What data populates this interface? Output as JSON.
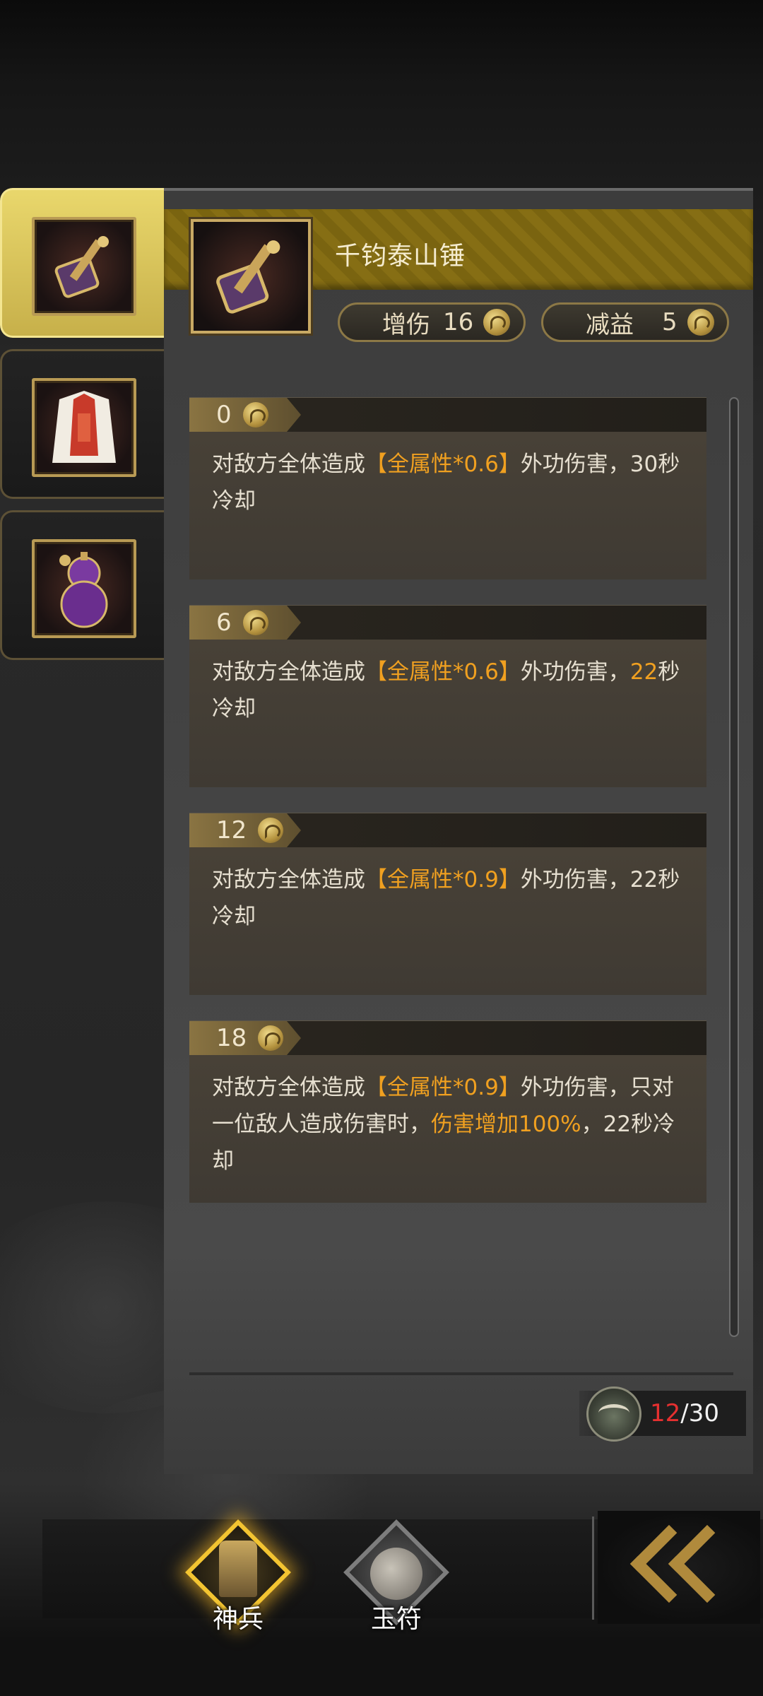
{
  "item": {
    "name": "千钧泰山锤",
    "stats": [
      {
        "label": "增伤",
        "value": "16"
      },
      {
        "label": "减益",
        "value": "5"
      }
    ]
  },
  "side_tabs": [
    {
      "icon": "hammer-icon",
      "active": true
    },
    {
      "icon": "robe-icon",
      "active": false
    },
    {
      "icon": "gourd-icon",
      "active": false
    }
  ],
  "tiers": [
    {
      "level": "0",
      "parts": [
        {
          "t": "对敌方全体造成"
        },
        {
          "t": "【全属性*0.6】",
          "hl": true
        },
        {
          "t": "外功伤害，30秒冷却"
        }
      ]
    },
    {
      "level": "6",
      "parts": [
        {
          "t": "对敌方全体造成"
        },
        {
          "t": "【全属性*0.6】",
          "hl": true
        },
        {
          "t": "外功伤害，"
        },
        {
          "t": "22",
          "hl": true
        },
        {
          "t": "秒冷却"
        }
      ]
    },
    {
      "level": "12",
      "parts": [
        {
          "t": "对敌方全体造成"
        },
        {
          "t": "【全属性*0.9】",
          "hl": true
        },
        {
          "t": "外功伤害，22秒冷却"
        }
      ]
    },
    {
      "level": "18",
      "parts": [
        {
          "t": "对敌方全体造成"
        },
        {
          "t": "【全属性*0.9】",
          "hl": true
        },
        {
          "t": "外功伤害，只对一位敌人造成伤害时，"
        },
        {
          "t": "伤害增加100%",
          "hl": true
        },
        {
          "t": "，22秒冷却"
        }
      ]
    }
  ],
  "counter": {
    "current": "12",
    "separator": "/",
    "max": "30"
  },
  "bottom_nav": {
    "weapon_label": "神兵",
    "jade_label": "玉符"
  },
  "colors": {
    "highlight": "#f0a020",
    "counter_current": "#e53030",
    "gold": "#c8a964"
  }
}
